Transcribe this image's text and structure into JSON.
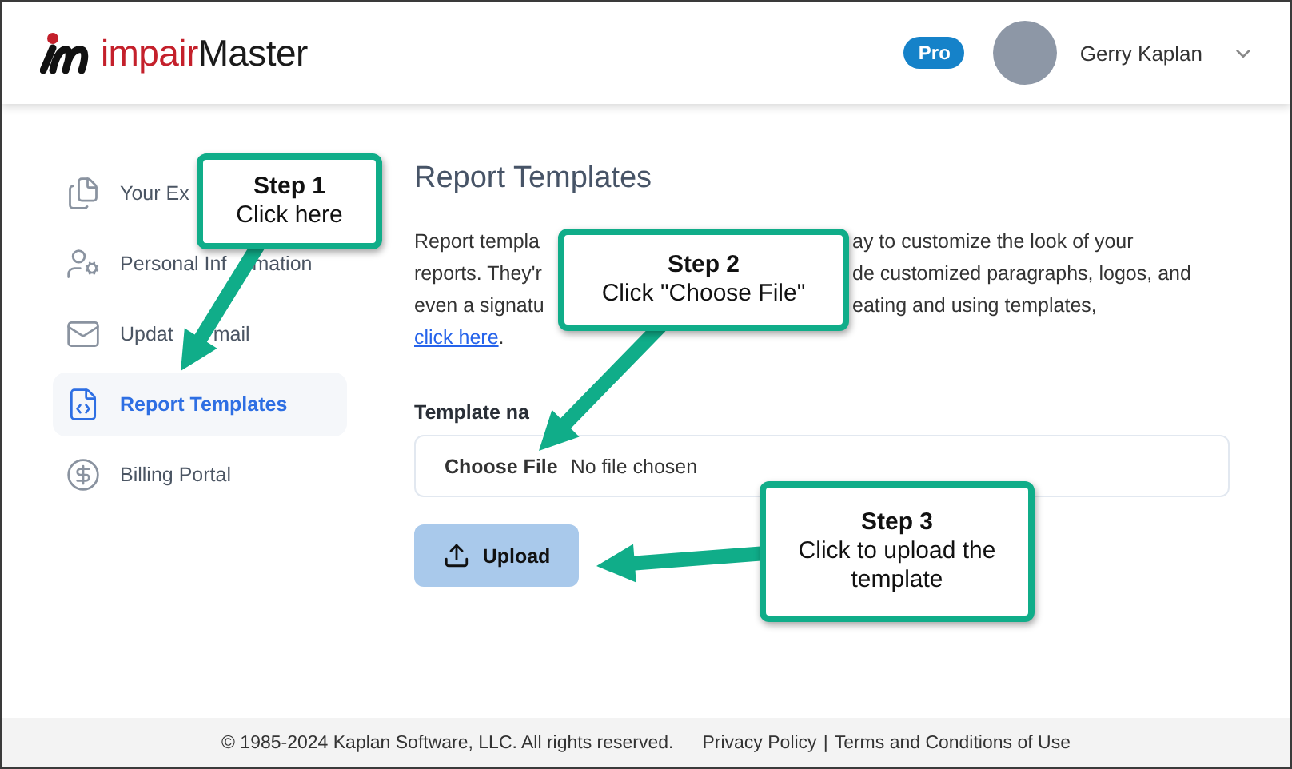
{
  "header": {
    "logo": {
      "first": "impair",
      "second": "Master"
    },
    "badge": "Pro",
    "user": {
      "name": "Gerry Kaplan"
    }
  },
  "sidebar": {
    "items": [
      {
        "label": [
          "Your Ex"
        ],
        "selected": false
      },
      {
        "label": [
          "Personal Inf",
          "mation"
        ],
        "selected": false
      },
      {
        "label": [
          "Updat",
          "mail"
        ],
        "selected": false
      },
      {
        "label": [
          "Report Templates"
        ],
        "selected": true
      },
      {
        "label": [
          "Billing Portal"
        ],
        "selected": false
      }
    ]
  },
  "content": {
    "title": "Report Templates",
    "intro": {
      "left": [
        "Report templa",
        "reports. They'r",
        "even a signatu"
      ],
      "right": [
        "ay to customize the look of your",
        "de customized paragraphs, logos, and",
        "eating and using templates,"
      ],
      "link": "click here",
      "end": "."
    },
    "field_label": "Template na",
    "file_input": {
      "button": "Choose File",
      "status": "No file chosen"
    },
    "upload_button": "Upload"
  },
  "callouts": [
    {
      "title": "Step 1",
      "text": "Click here"
    },
    {
      "title": "Step 2",
      "text": "Click \"Choose File\""
    },
    {
      "title": "Step 3",
      "text": "Click to upload the template"
    }
  ],
  "footer": {
    "copyright": "© 1985-2024 Kaplan Software, LLC. All rights reserved.",
    "links": [
      "Privacy Policy",
      "Terms and Conditions of Use"
    ],
    "separator": "|"
  }
}
